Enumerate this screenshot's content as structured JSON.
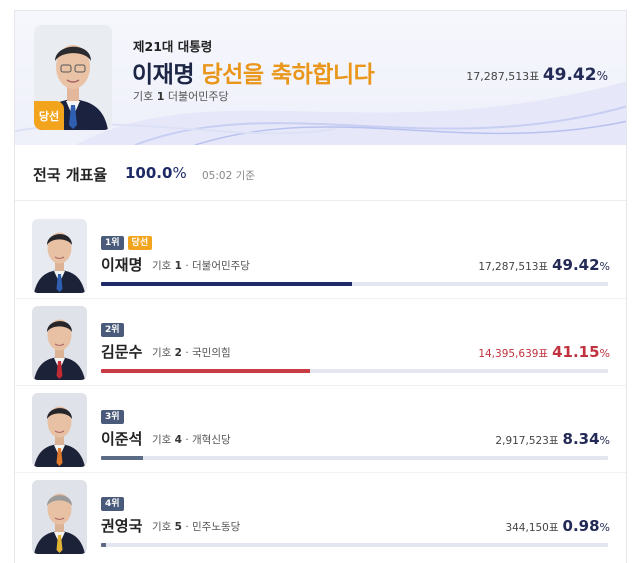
{
  "banner": {
    "subtitle": "제21대 대통령",
    "winner_name": "이재명",
    "message": "당선을 축하합니다",
    "symbol_label": "기호",
    "symbol_no": "1",
    "party": "더불어민주당",
    "votes": "17,287,513표",
    "percent": "49.42",
    "percent_sign": "%",
    "elected_badge": "당선"
  },
  "count": {
    "label": "전국 개표율",
    "value": "100.0",
    "percent_sign": "%",
    "time": "05:02 기준"
  },
  "candidates": [
    {
      "rank": "1위",
      "elected": "당선",
      "name": "이재명",
      "symbol_label": "기호",
      "symbol_no": "1",
      "party": "더불어민주당",
      "votes": "17,287,513표",
      "percent": "49.42",
      "percent_sign": "%",
      "share": 0.4942,
      "bar_color": "#1f2a6b",
      "tie_color": "#2f5fb0"
    },
    {
      "rank": "2위",
      "name": "김문수",
      "symbol_label": "기호",
      "symbol_no": "2",
      "party": "국민의힘",
      "votes": "14,395,639표",
      "percent": "41.15",
      "percent_sign": "%",
      "share": 0.4115,
      "bar_color": "#c83a44",
      "tie_color": "#c02a35"
    },
    {
      "rank": "3위",
      "name": "이준석",
      "symbol_label": "기호",
      "symbol_no": "4",
      "party": "개혁신당",
      "votes": "2,917,523표",
      "percent": "8.34",
      "percent_sign": "%",
      "share": 0.0834,
      "bar_color": "#5b6b85",
      "tie_color": "#e07a2a"
    },
    {
      "rank": "4위",
      "name": "권영국",
      "symbol_label": "기호",
      "symbol_no": "5",
      "party": "민주노동당",
      "votes": "344,150표",
      "percent": "0.98",
      "percent_sign": "%",
      "share": 0.0098,
      "bar_color": "#5b6b85",
      "tie_color": "#e2b534"
    }
  ],
  "colors": {
    "navy": "#1f2a6b",
    "accent_orange": "#e9961a",
    "red": "#c0323d",
    "gray_bar": "#5b6b85"
  },
  "icons": {
    "portrait": "candidate-photo"
  }
}
